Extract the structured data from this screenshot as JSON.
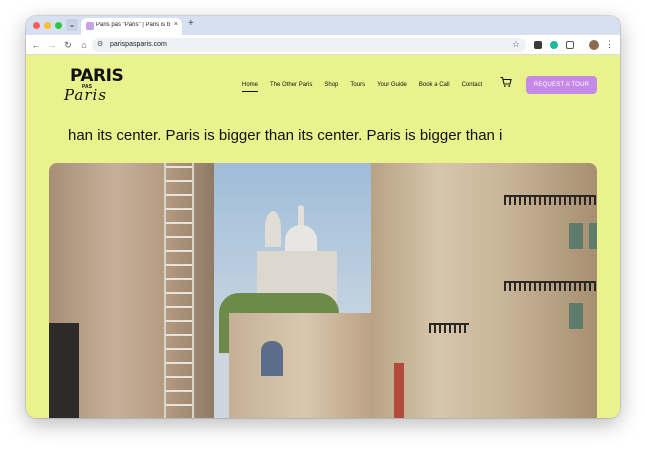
{
  "browser": {
    "tab_title": "Paris pas \"Paris\" | Paris is big",
    "tab_close": "×",
    "new_tab": "+",
    "url": "parispasparis.com",
    "menu_glyph": "⌄"
  },
  "site": {
    "logo": {
      "line1": "PARIS",
      "line2": "PAS",
      "line3": "Paris"
    },
    "nav": [
      {
        "label": "Home",
        "active": true
      },
      {
        "label": "The Other Paris"
      },
      {
        "label": "Shop"
      },
      {
        "label": "Tours"
      },
      {
        "label": "Your Guide"
      },
      {
        "label": "Book a Call"
      },
      {
        "label": "Contact"
      }
    ],
    "cta_label": "REQUEST A TOUR",
    "marquee": "han its center.  Paris is bigger than its center.  Paris is bigger than i"
  },
  "colors": {
    "page_background": "#e9f28c",
    "cta": "#c58ae8"
  },
  "icons": [
    "back-icon",
    "forward-icon",
    "reload-icon",
    "home-icon",
    "site-info-icon",
    "star-icon",
    "extension-icon",
    "cart-icon",
    "profile-avatar",
    "menu-icon"
  ]
}
